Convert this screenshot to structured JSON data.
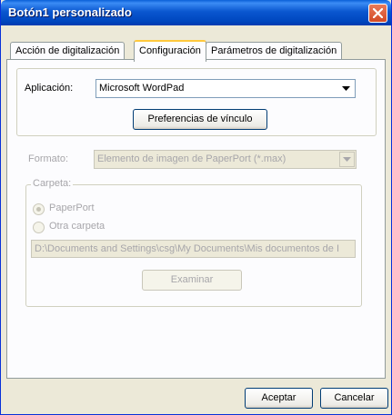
{
  "window": {
    "title": "Botón1 personalizado"
  },
  "tabs": [
    {
      "label": "Acción de digitalización"
    },
    {
      "label": "Configuración"
    },
    {
      "label": "Parámetros de digitalización"
    }
  ],
  "application": {
    "label": "Aplicación:",
    "value": "Microsoft WordPad",
    "link_prefs_label": "Preferencias de vínculo"
  },
  "format": {
    "label": "Formato:",
    "value": "Elemento de imagen de PaperPort (*.max)"
  },
  "folder": {
    "label": "Carpeta:",
    "option_paperport": "PaperPort",
    "option_other": "Otra carpeta",
    "selected": "PaperPort",
    "path": "D:\\Documents and Settings\\csg\\My Documents\\Mis documentos de I",
    "browse_label": "Examinar"
  },
  "footer": {
    "ok_label": "Aceptar",
    "cancel_label": "Cancelar"
  },
  "colors": {
    "titlebar": "#0054e3",
    "close_button": "#d34a25",
    "active_tab_highlight": "#ffc83c"
  }
}
